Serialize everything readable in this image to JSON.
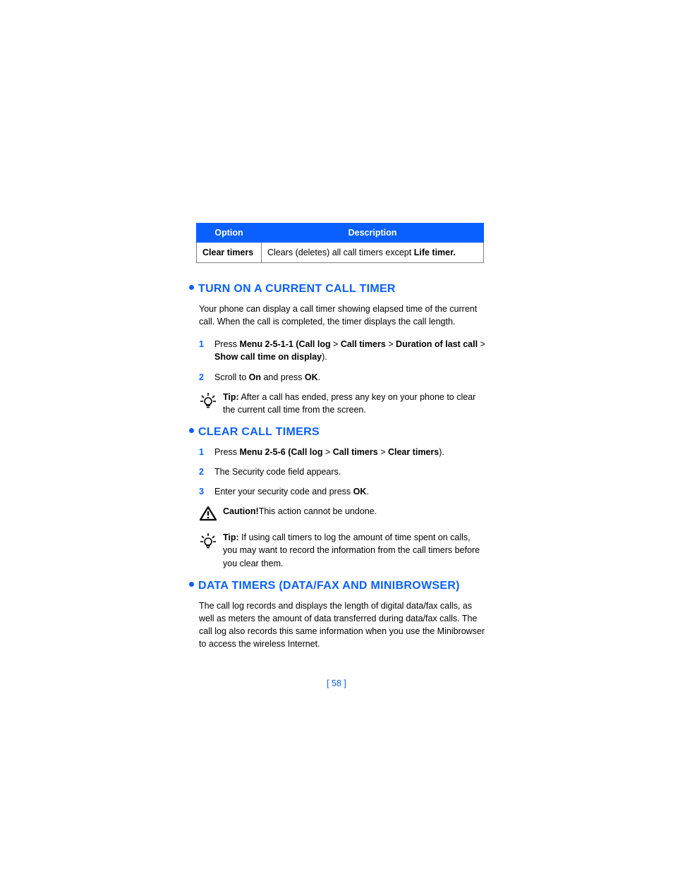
{
  "table": {
    "headers": [
      "Option",
      "Description"
    ],
    "row": {
      "option": "Clear timers",
      "desc_pre": "Clears (deletes) all call timers except ",
      "desc_bold": "Life timer."
    }
  },
  "sections": [
    {
      "title": "TURN ON A CURRENT CALL TIMER",
      "intro": "Your phone can display a call timer showing elapsed time of the current call. When the call is completed, the timer displays the call length.",
      "step1_pre": "Press ",
      "step1_b1": "Menu 2-5-1-1 (Call log",
      "step1_gt1": " > ",
      "step1_b2": "Call timers",
      "step1_gt2": " > ",
      "step1_b3": "Duration of last call",
      "step1_gt3": " > ",
      "step1_b4": "Show call time on display",
      "step1_post": ").",
      "step2_pre": "Scroll to ",
      "step2_b1": "On",
      "step2_mid": " and press ",
      "step2_b2": "OK",
      "step2_post": ".",
      "tip_label": "Tip:",
      "tip_text": " After a call has ended, press any key on your phone to clear the current call time from the screen."
    },
    {
      "title": "CLEAR CALL TIMERS",
      "step1_pre": "Press ",
      "step1_b1": "Menu 2-5-6 (Call log",
      "step1_gt1": " > ",
      "step1_b2": "Call timers",
      "step1_gt2": " > ",
      "step1_b3": "Clear timers",
      "step1_post": ").",
      "step2": "The Security code field appears.",
      "step3_pre": "Enter your security code and press ",
      "step3_b1": "OK",
      "step3_post": ".",
      "caution_label": "Caution!",
      "caution_text": "This action cannot be undone.",
      "tip_label": "Tip:",
      "tip_text": " If using call timers to log the amount of time spent on calls, you may want to record the information from the call timers before you clear them."
    },
    {
      "title": "DATA TIMERS (DATA/FAX AND MINIBROWSER)",
      "intro": "The call log records and displays the length of digital data/fax calls, as well as meters the amount of data transferred during data/fax calls. The call log also records this same information when you use the Minibrowser to access the wireless Internet."
    }
  ],
  "page_number": "[ 58 ]"
}
